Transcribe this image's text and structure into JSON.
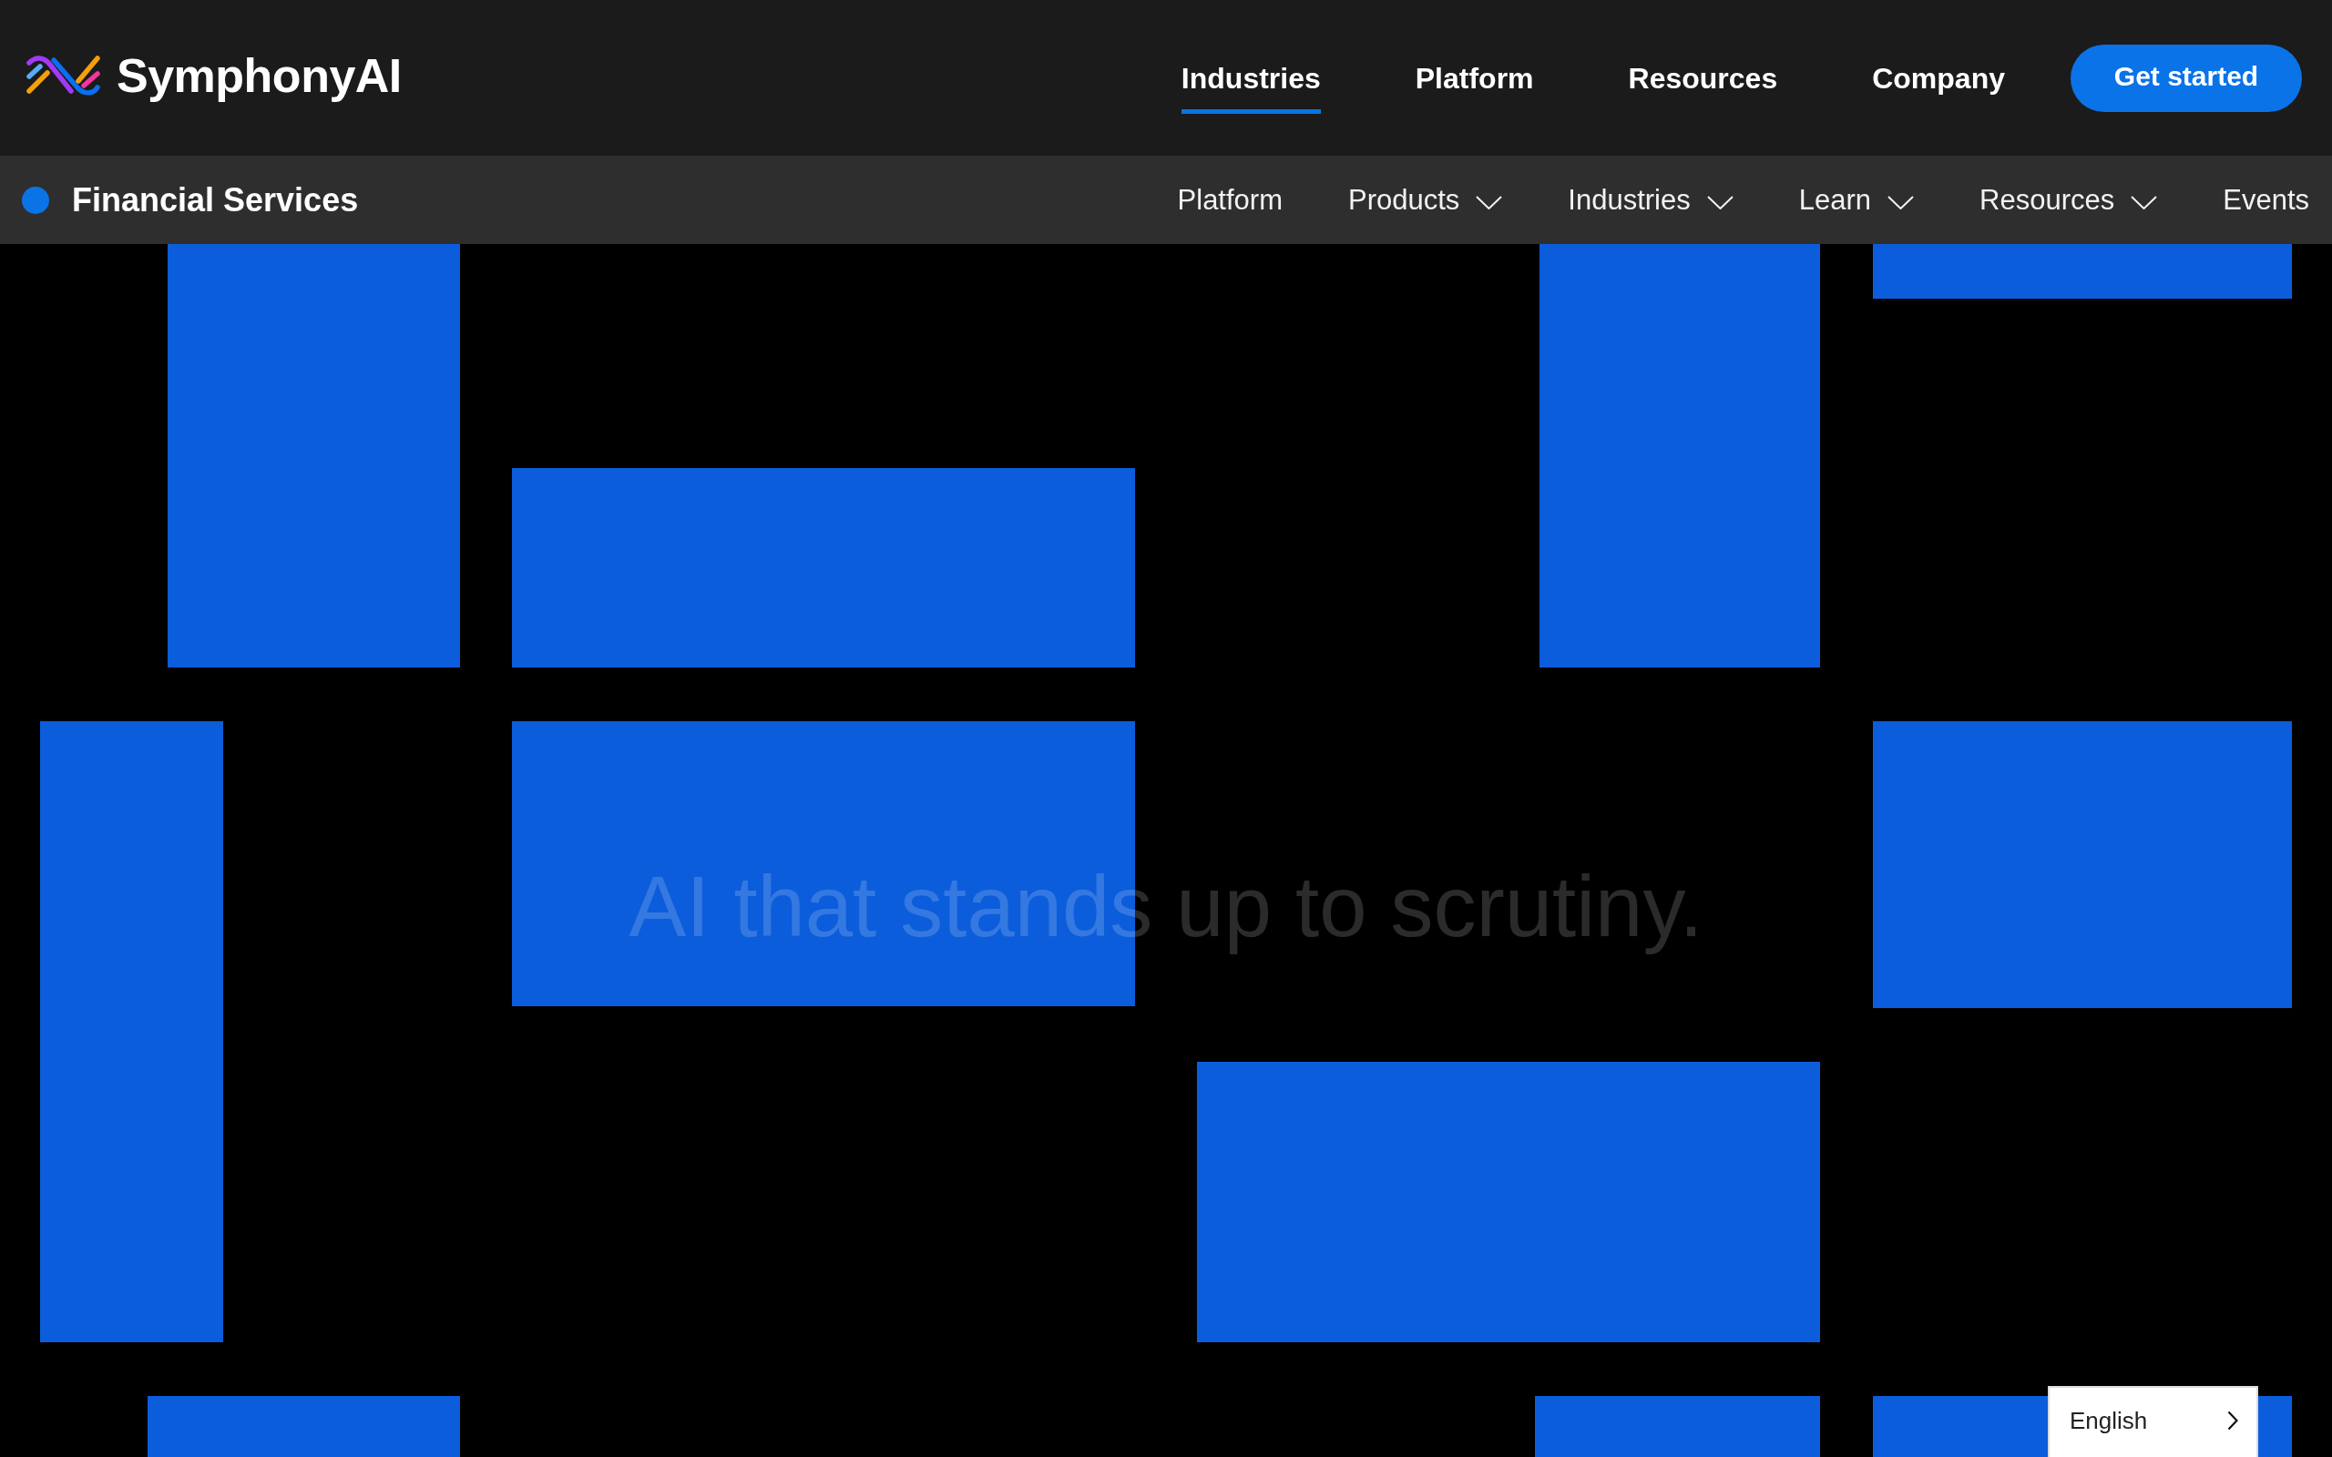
{
  "header": {
    "logo": {
      "text": "SymphonyAI"
    },
    "nav": [
      {
        "label": "Industries",
        "selected": true
      },
      {
        "label": "Platform",
        "selected": false
      },
      {
        "label": "Resources",
        "selected": false
      },
      {
        "label": "Company",
        "selected": false
      }
    ],
    "cta": "Get started"
  },
  "section_bar": {
    "title": "Financial Services",
    "items": [
      {
        "label": "Platform",
        "kind": "link"
      },
      {
        "label": "Products",
        "kind": "dropdown"
      },
      {
        "label": "Industries",
        "kind": "dropdown"
      },
      {
        "label": "Learn",
        "kind": "dropdown"
      },
      {
        "label": "Resources",
        "kind": "dropdown"
      },
      {
        "label": "Events",
        "kind": "link"
      }
    ]
  },
  "hero": {
    "headline": "AI that stands up to scrutiny."
  },
  "language_selector": {
    "label": "English"
  }
}
